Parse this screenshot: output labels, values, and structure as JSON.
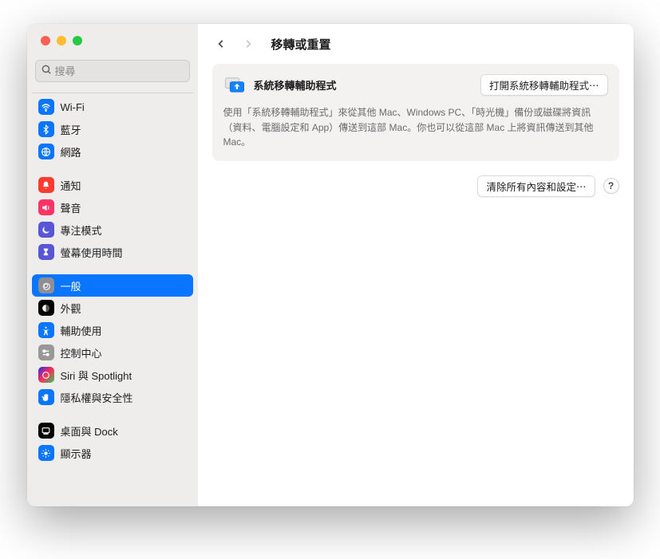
{
  "search": {
    "placeholder": "搜尋"
  },
  "page": {
    "title": "移轉或重置"
  },
  "card": {
    "title": "系統移轉輔助程式",
    "open_button": "打開系統移轉輔助程式⋯",
    "description": "使用「系統移轉輔助程式」來從其他 Mac、Windows PC、「時光機」備份或磁碟將資訊（資料、電腦設定和 App）傳送到這部 Mac。你也可以從這部 Mac 上將資訊傳送到其他 Mac。"
  },
  "actions": {
    "erase_button": "清除所有內容和設定⋯",
    "help": "?"
  },
  "sidebar": {
    "g0": [
      {
        "label": "Wi-Fi",
        "bg": "#0a75ff",
        "icon": "wifi"
      },
      {
        "label": "藍牙",
        "bg": "#0a75ff",
        "icon": "bluetooth"
      },
      {
        "label": "網路",
        "bg": "#0a75ff",
        "icon": "globe"
      }
    ],
    "g1": [
      {
        "label": "通知",
        "bg": "#ff3b30",
        "icon": "bell"
      },
      {
        "label": "聲音",
        "bg": "#ff3366",
        "icon": "sound"
      },
      {
        "label": "專注模式",
        "bg": "#5856d6",
        "icon": "moon"
      },
      {
        "label": "螢幕使用時間",
        "bg": "#5856d6",
        "icon": "hourglass"
      }
    ],
    "g2": [
      {
        "label": "一般",
        "bg": "#8e8e93",
        "icon": "gear"
      },
      {
        "label": "外觀",
        "bg": "#000000",
        "icon": "appearance"
      },
      {
        "label": "輔助使用",
        "bg": "#0a75ff",
        "icon": "accessibility"
      },
      {
        "label": "控制中心",
        "bg": "#989898",
        "icon": "switches"
      },
      {
        "label": "Siri 與 Spotlight",
        "bg": "#000000",
        "icon": "siri"
      },
      {
        "label": "隱私權與安全性",
        "bg": "#0a75ff",
        "icon": "hand"
      }
    ],
    "g3": [
      {
        "label": "桌面與 Dock",
        "bg": "#000000",
        "icon": "dock"
      },
      {
        "label": "顯示器",
        "bg": "#0a75ff",
        "icon": "display"
      }
    ]
  }
}
